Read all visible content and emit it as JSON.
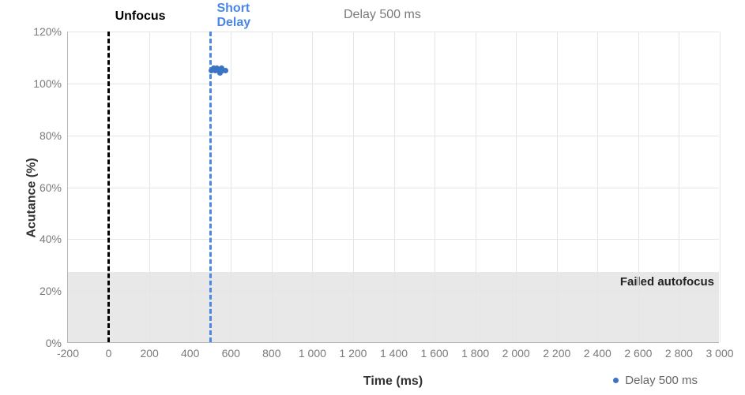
{
  "chart_data": {
    "type": "scatter",
    "title": "Delay 500 ms",
    "xlabel": "Time (ms)",
    "ylabel": "Acutance (%)",
    "xlim": [
      -200,
      3000
    ],
    "ylim": [
      0,
      120
    ],
    "xticks": [
      -200,
      0,
      200,
      400,
      600,
      800,
      1000,
      1200,
      1400,
      1600,
      1800,
      2000,
      2200,
      2400,
      2600,
      2800,
      3000
    ],
    "xtick_labels": [
      "-200",
      "0",
      "200",
      "400",
      "600",
      "800",
      "1 000",
      "1 200",
      "1 400",
      "1 600",
      "1 800",
      "2 000",
      "2 200",
      "2 400",
      "2 600",
      "2 800",
      "3 000"
    ],
    "yticks": [
      0,
      20,
      40,
      60,
      80,
      100,
      120
    ],
    "ytick_labels": [
      "0%",
      "20%",
      "40%",
      "60%",
      "80%",
      "100%",
      "120%"
    ],
    "vlines": [
      {
        "x": 0,
        "label": "Unfocus",
        "style": "black"
      },
      {
        "x": 500,
        "label": "Short\nDelay",
        "style": "blue"
      }
    ],
    "failed_band": {
      "ymax": 27,
      "label": "Failed autofocus"
    },
    "series": [
      {
        "name": "Delay 500 ms",
        "color": "#3b74c4",
        "points": [
          {
            "x": 505,
            "y": 105
          },
          {
            "x": 515,
            "y": 106
          },
          {
            "x": 525,
            "y": 105
          },
          {
            "x": 530,
            "y": 106
          },
          {
            "x": 540,
            "y": 105
          },
          {
            "x": 545,
            "y": 104
          },
          {
            "x": 555,
            "y": 106
          },
          {
            "x": 560,
            "y": 105
          },
          {
            "x": 575,
            "y": 105
          }
        ]
      }
    ],
    "legend": {
      "label": "Delay 500 ms"
    }
  }
}
